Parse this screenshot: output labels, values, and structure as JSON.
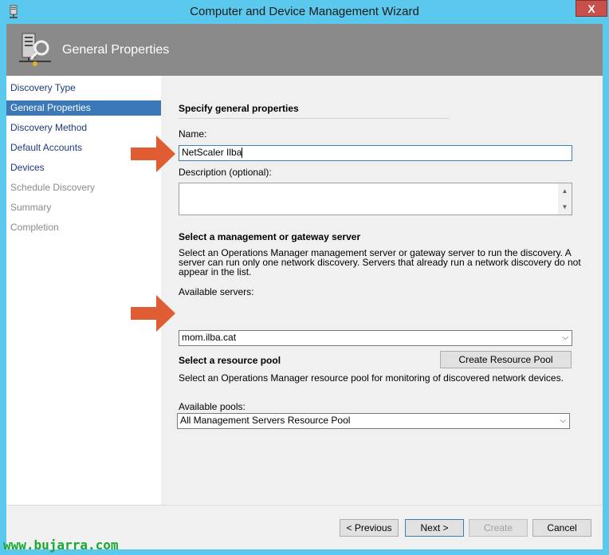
{
  "window": {
    "title": "Computer and Device Management Wizard",
    "close_label": "X"
  },
  "header": {
    "title": "General Properties"
  },
  "nav": {
    "items": [
      {
        "label": "Discovery Type",
        "state": "normal"
      },
      {
        "label": "General Properties",
        "state": "active"
      },
      {
        "label": "Discovery Method",
        "state": "normal"
      },
      {
        "label": "Default Accounts",
        "state": "normal"
      },
      {
        "label": "Devices",
        "state": "normal"
      },
      {
        "label": "Schedule Discovery",
        "state": "disabled"
      },
      {
        "label": "Summary",
        "state": "disabled"
      },
      {
        "label": "Completion",
        "state": "disabled"
      }
    ]
  },
  "general": {
    "heading": "Specify general properties",
    "name_label": "Name:",
    "name_value": "NetScaler Ilba",
    "description_label": "Description (optional):",
    "description_value": ""
  },
  "server": {
    "heading": "Select a management or gateway server",
    "description_line1": "Select an Operations Manager management server or gateway server to run the discovery. A",
    "description_line2": "server can run only one network discovery. Servers that already run a network discovery do not",
    "description_line3": "appear in the list.",
    "available_label": "Available servers:",
    "selected": "mom.ilba.cat"
  },
  "pool": {
    "heading": "Select a resource pool",
    "create_button": "Create Resource Pool",
    "description": "Select an Operations Manager resource pool for monitoring of discovered network devices.",
    "available_label": "Available pools:",
    "selected": "All Management Servers Resource Pool"
  },
  "footer": {
    "previous": "< Previous",
    "next": "Next >",
    "create": "Create",
    "cancel": "Cancel"
  },
  "watermark": "www.bujarra.com",
  "colors": {
    "title_bar": "#5bc8ee",
    "header": "#8a8a8a",
    "nav_active": "#3b78b8",
    "arrow": "#e05c33",
    "watermark": "#1aa832"
  }
}
